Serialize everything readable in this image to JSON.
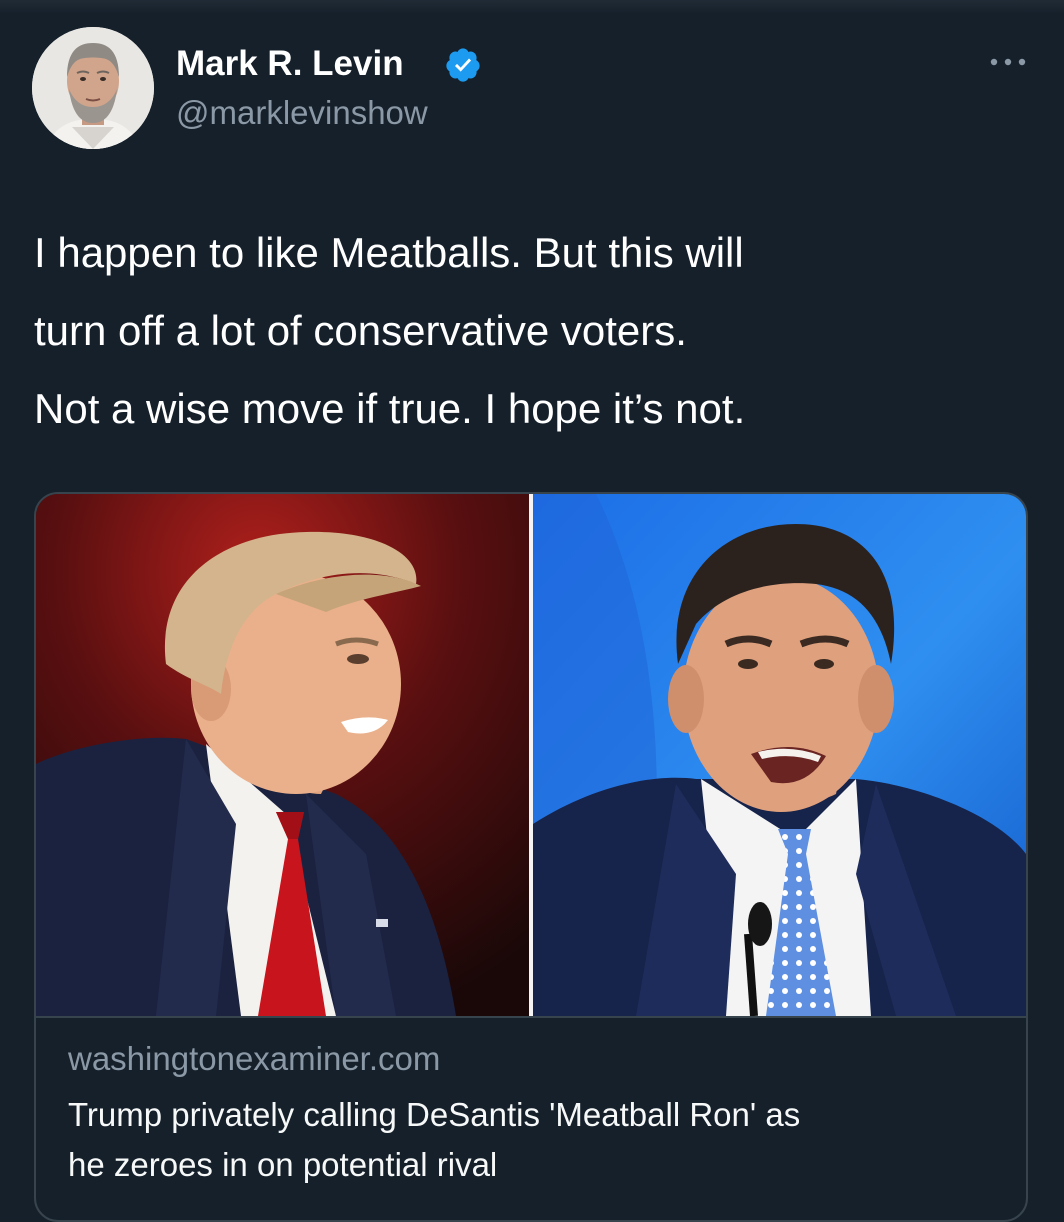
{
  "tweet": {
    "author": {
      "display_name": "Mark R. Levin",
      "handle": "@marklevinshow",
      "verified_icon": "verified-badge-icon",
      "avatar_icon": "avatar-photo"
    },
    "more_icon": "more-options-icon",
    "text_lines": [
      "I happen to like Meatballs. But this will",
      "turn off a lot of conservative voters.",
      "Not a wise move if true.  I hope it’s not."
    ]
  },
  "link_card": {
    "image_icon": "article-photo-two-politicians",
    "domain": "washingtonexaminer.com",
    "title_lines": [
      "Trump privately calling DeSantis 'Meatball Ron' as",
      "he zeroes in on potential rival"
    ]
  },
  "colors": {
    "background": "#15202b",
    "text_primary": "#ffffff",
    "text_secondary": "#8b98a5",
    "verified_blue": "#1d9bf0",
    "card_border": "#38444d"
  }
}
